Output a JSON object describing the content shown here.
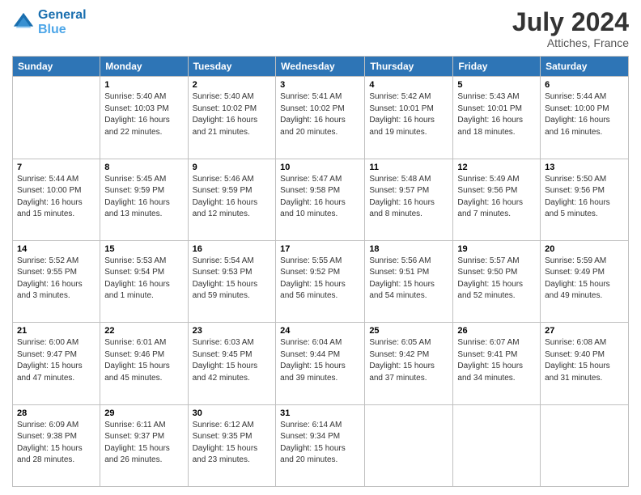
{
  "header": {
    "logo_line1": "General",
    "logo_line2": "Blue",
    "month_year": "July 2024",
    "location": "Attiches, France"
  },
  "days_of_week": [
    "Sunday",
    "Monday",
    "Tuesday",
    "Wednesday",
    "Thursday",
    "Friday",
    "Saturday"
  ],
  "weeks": [
    [
      {
        "day": "",
        "info": ""
      },
      {
        "day": "1",
        "info": "Sunrise: 5:40 AM\nSunset: 10:03 PM\nDaylight: 16 hours\nand 22 minutes."
      },
      {
        "day": "2",
        "info": "Sunrise: 5:40 AM\nSunset: 10:02 PM\nDaylight: 16 hours\nand 21 minutes."
      },
      {
        "day": "3",
        "info": "Sunrise: 5:41 AM\nSunset: 10:02 PM\nDaylight: 16 hours\nand 20 minutes."
      },
      {
        "day": "4",
        "info": "Sunrise: 5:42 AM\nSunset: 10:01 PM\nDaylight: 16 hours\nand 19 minutes."
      },
      {
        "day": "5",
        "info": "Sunrise: 5:43 AM\nSunset: 10:01 PM\nDaylight: 16 hours\nand 18 minutes."
      },
      {
        "day": "6",
        "info": "Sunrise: 5:44 AM\nSunset: 10:00 PM\nDaylight: 16 hours\nand 16 minutes."
      }
    ],
    [
      {
        "day": "7",
        "info": "Sunrise: 5:44 AM\nSunset: 10:00 PM\nDaylight: 16 hours\nand 15 minutes."
      },
      {
        "day": "8",
        "info": "Sunrise: 5:45 AM\nSunset: 9:59 PM\nDaylight: 16 hours\nand 13 minutes."
      },
      {
        "day": "9",
        "info": "Sunrise: 5:46 AM\nSunset: 9:59 PM\nDaylight: 16 hours\nand 12 minutes."
      },
      {
        "day": "10",
        "info": "Sunrise: 5:47 AM\nSunset: 9:58 PM\nDaylight: 16 hours\nand 10 minutes."
      },
      {
        "day": "11",
        "info": "Sunrise: 5:48 AM\nSunset: 9:57 PM\nDaylight: 16 hours\nand 8 minutes."
      },
      {
        "day": "12",
        "info": "Sunrise: 5:49 AM\nSunset: 9:56 PM\nDaylight: 16 hours\nand 7 minutes."
      },
      {
        "day": "13",
        "info": "Sunrise: 5:50 AM\nSunset: 9:56 PM\nDaylight: 16 hours\nand 5 minutes."
      }
    ],
    [
      {
        "day": "14",
        "info": "Sunrise: 5:52 AM\nSunset: 9:55 PM\nDaylight: 16 hours\nand 3 minutes."
      },
      {
        "day": "15",
        "info": "Sunrise: 5:53 AM\nSunset: 9:54 PM\nDaylight: 16 hours\nand 1 minute."
      },
      {
        "day": "16",
        "info": "Sunrise: 5:54 AM\nSunset: 9:53 PM\nDaylight: 15 hours\nand 59 minutes."
      },
      {
        "day": "17",
        "info": "Sunrise: 5:55 AM\nSunset: 9:52 PM\nDaylight: 15 hours\nand 56 minutes."
      },
      {
        "day": "18",
        "info": "Sunrise: 5:56 AM\nSunset: 9:51 PM\nDaylight: 15 hours\nand 54 minutes."
      },
      {
        "day": "19",
        "info": "Sunrise: 5:57 AM\nSunset: 9:50 PM\nDaylight: 15 hours\nand 52 minutes."
      },
      {
        "day": "20",
        "info": "Sunrise: 5:59 AM\nSunset: 9:49 PM\nDaylight: 15 hours\nand 49 minutes."
      }
    ],
    [
      {
        "day": "21",
        "info": "Sunrise: 6:00 AM\nSunset: 9:47 PM\nDaylight: 15 hours\nand 47 minutes."
      },
      {
        "day": "22",
        "info": "Sunrise: 6:01 AM\nSunset: 9:46 PM\nDaylight: 15 hours\nand 45 minutes."
      },
      {
        "day": "23",
        "info": "Sunrise: 6:03 AM\nSunset: 9:45 PM\nDaylight: 15 hours\nand 42 minutes."
      },
      {
        "day": "24",
        "info": "Sunrise: 6:04 AM\nSunset: 9:44 PM\nDaylight: 15 hours\nand 39 minutes."
      },
      {
        "day": "25",
        "info": "Sunrise: 6:05 AM\nSunset: 9:42 PM\nDaylight: 15 hours\nand 37 minutes."
      },
      {
        "day": "26",
        "info": "Sunrise: 6:07 AM\nSunset: 9:41 PM\nDaylight: 15 hours\nand 34 minutes."
      },
      {
        "day": "27",
        "info": "Sunrise: 6:08 AM\nSunset: 9:40 PM\nDaylight: 15 hours\nand 31 minutes."
      }
    ],
    [
      {
        "day": "28",
        "info": "Sunrise: 6:09 AM\nSunset: 9:38 PM\nDaylight: 15 hours\nand 28 minutes."
      },
      {
        "day": "29",
        "info": "Sunrise: 6:11 AM\nSunset: 9:37 PM\nDaylight: 15 hours\nand 26 minutes."
      },
      {
        "day": "30",
        "info": "Sunrise: 6:12 AM\nSunset: 9:35 PM\nDaylight: 15 hours\nand 23 minutes."
      },
      {
        "day": "31",
        "info": "Sunrise: 6:14 AM\nSunset: 9:34 PM\nDaylight: 15 hours\nand 20 minutes."
      },
      {
        "day": "",
        "info": ""
      },
      {
        "day": "",
        "info": ""
      },
      {
        "day": "",
        "info": ""
      }
    ]
  ]
}
